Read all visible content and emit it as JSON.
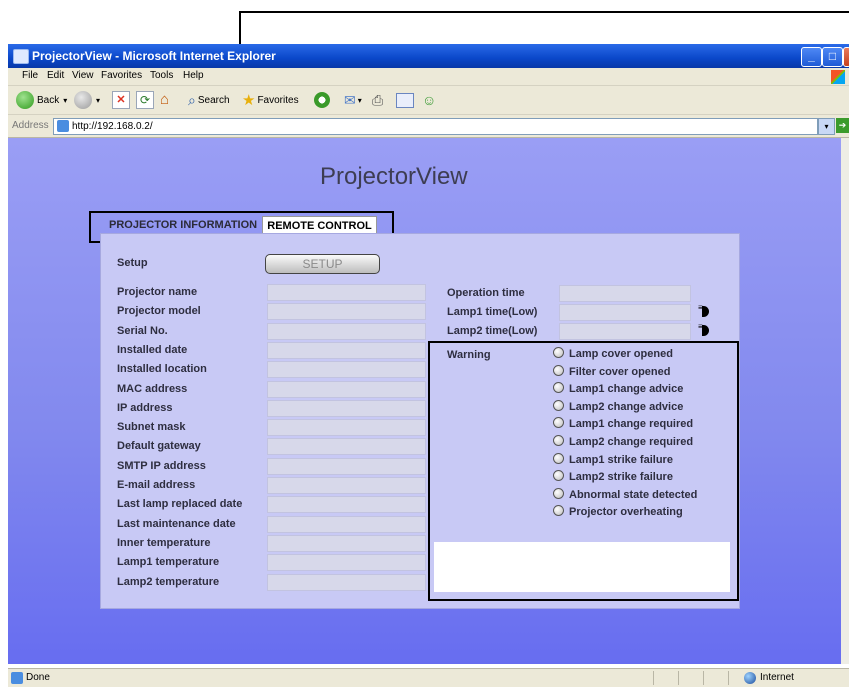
{
  "window": {
    "title": "ProjectorView - Microsoft Internet Explorer",
    "controls": {
      "minimize": "_",
      "maximize": "□",
      "close": "X"
    }
  },
  "menu": [
    "File",
    "Edit",
    "View",
    "Favorites",
    "Tools",
    "Help"
  ],
  "toolbar": {
    "back": "Back",
    "search": "Search",
    "favorites": "Favorites"
  },
  "address": {
    "label": "Address",
    "url": "http://192.168.0.2/",
    "go": "Go"
  },
  "page": {
    "title": "ProjectorView",
    "tabs": [
      "PROJECTOR INFORMATION",
      "REMOTE CONTROL"
    ],
    "setup": {
      "label": "Setup",
      "button": "SETUP"
    },
    "left_fields": [
      "Projector name",
      "Projector model",
      "Serial No.",
      "Installed date",
      "Installed location",
      "MAC address",
      "IP address",
      "Subnet mask",
      "Default gateway",
      "SMTP IP address",
      "E-mail address",
      "Last lamp replaced date",
      "Last maintenance date",
      "Inner temperature",
      "Lamp1 temperature",
      "Lamp2 temperature"
    ],
    "right_fields": [
      "Operation time",
      "Lamp1 time(Low)",
      "Lamp2 time(Low)"
    ],
    "warning": {
      "label": "Warning",
      "items": [
        "Lamp cover opened",
        "Filter cover opened",
        "Lamp1 change advice",
        "Lamp2 change advice",
        "Lamp1 change required",
        "Lamp2 change required",
        "Lamp1 strike failure",
        "Lamp2 strike failure",
        "Abnormal state detected",
        "Projector overheating"
      ]
    }
  },
  "status": {
    "text": "Done",
    "zone": "Internet"
  }
}
